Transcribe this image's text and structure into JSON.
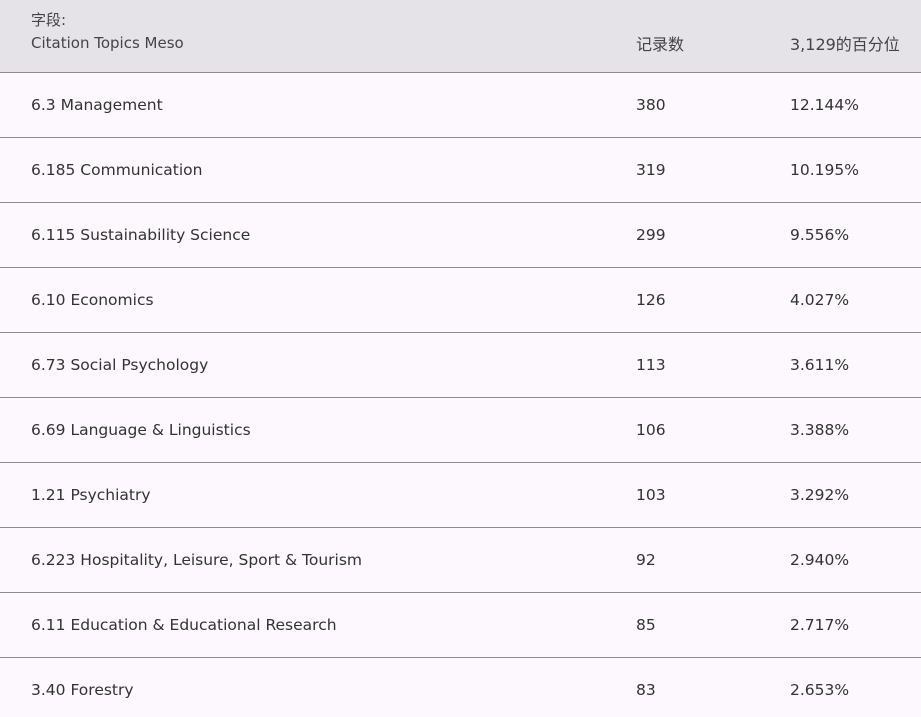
{
  "header": {
    "field_label": "字段:",
    "field_name": "Citation Topics Meso",
    "count_label": "记录数",
    "percent_label": "3,129的百分位"
  },
  "rows": [
    {
      "topic": "6.3 Management",
      "count": "380",
      "percent": "12.144%"
    },
    {
      "topic": "6.185 Communication",
      "count": "319",
      "percent": "10.195%"
    },
    {
      "topic": "6.115 Sustainability Science",
      "count": "299",
      "percent": "9.556%"
    },
    {
      "topic": "6.10 Economics",
      "count": "126",
      "percent": "4.027%"
    },
    {
      "topic": "6.73 Social Psychology",
      "count": "113",
      "percent": "3.611%"
    },
    {
      "topic": "6.69 Language & Linguistics",
      "count": "106",
      "percent": "3.388%"
    },
    {
      "topic": "1.21 Psychiatry",
      "count": "103",
      "percent": "3.292%"
    },
    {
      "topic": "6.223 Hospitality, Leisure, Sport & Tourism",
      "count": "92",
      "percent": "2.940%"
    },
    {
      "topic": "6.11 Education & Educational Research",
      "count": "85",
      "percent": "2.717%"
    },
    {
      "topic": "3.40 Forestry",
      "count": "83",
      "percent": "2.653%"
    }
  ]
}
